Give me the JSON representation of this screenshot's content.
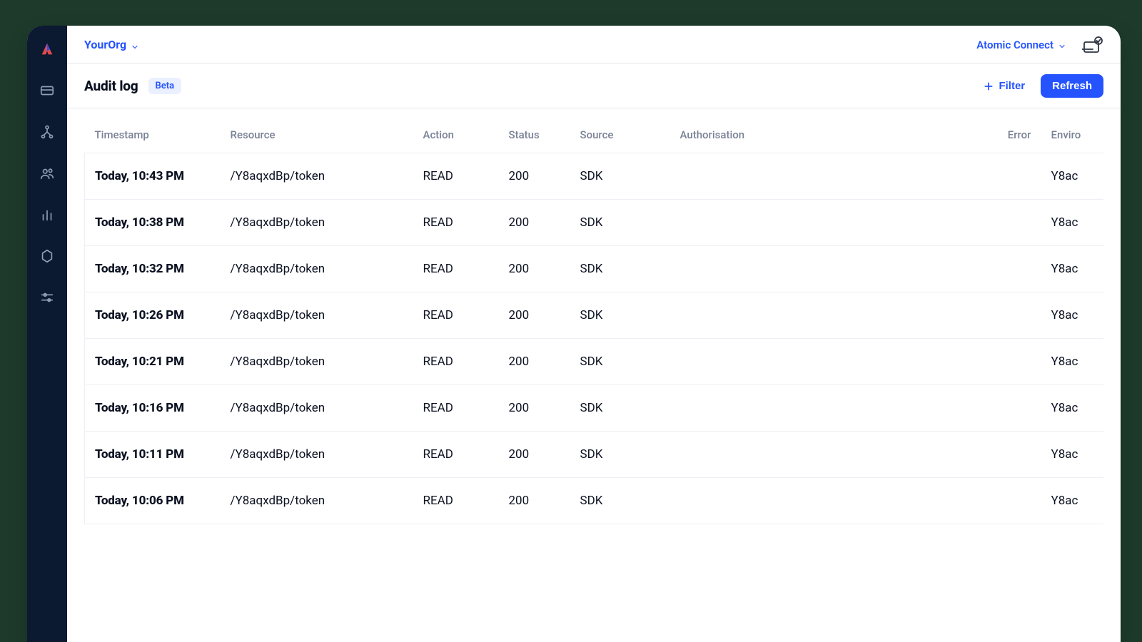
{
  "topbar": {
    "org_label": "YourOrg",
    "connect_label": "Atomic Connect"
  },
  "header": {
    "title": "Audit log",
    "beta_label": "Beta",
    "filter_label": "Filter",
    "refresh_label": "Refresh"
  },
  "table": {
    "columns": {
      "timestamp": "Timestamp",
      "resource": "Resource",
      "action": "Action",
      "status": "Status",
      "source": "Source",
      "authorisation": "Authorisation",
      "error": "Error",
      "environment": "Enviro"
    },
    "rows": [
      {
        "timestamp": "Today, 10:43 PM",
        "resource": "/Y8aqxdBp/token",
        "action": "READ",
        "status": "200",
        "source": "SDK",
        "authorisation": "",
        "error": "",
        "environment": "Y8ac"
      },
      {
        "timestamp": "Today, 10:38 PM",
        "resource": "/Y8aqxdBp/token",
        "action": "READ",
        "status": "200",
        "source": "SDK",
        "authorisation": "",
        "error": "",
        "environment": "Y8ac"
      },
      {
        "timestamp": "Today, 10:32 PM",
        "resource": "/Y8aqxdBp/token",
        "action": "READ",
        "status": "200",
        "source": "SDK",
        "authorisation": "",
        "error": "",
        "environment": "Y8ac"
      },
      {
        "timestamp": "Today, 10:26 PM",
        "resource": "/Y8aqxdBp/token",
        "action": "READ",
        "status": "200",
        "source": "SDK",
        "authorisation": "",
        "error": "",
        "environment": "Y8ac"
      },
      {
        "timestamp": "Today, 10:21 PM",
        "resource": "/Y8aqxdBp/token",
        "action": "READ",
        "status": "200",
        "source": "SDK",
        "authorisation": "",
        "error": "",
        "environment": "Y8ac"
      },
      {
        "timestamp": "Today, 10:16 PM",
        "resource": "/Y8aqxdBp/token",
        "action": "READ",
        "status": "200",
        "source": "SDK",
        "authorisation": "",
        "error": "",
        "environment": "Y8ac"
      },
      {
        "timestamp": "Today, 10:11 PM",
        "resource": "/Y8aqxdBp/token",
        "action": "READ",
        "status": "200",
        "source": "SDK",
        "authorisation": "",
        "error": "",
        "environment": "Y8ac"
      },
      {
        "timestamp": "Today, 10:06 PM",
        "resource": "/Y8aqxdBp/token",
        "action": "READ",
        "status": "200",
        "source": "SDK",
        "authorisation": "",
        "error": "",
        "environment": "Y8ac"
      }
    ]
  }
}
